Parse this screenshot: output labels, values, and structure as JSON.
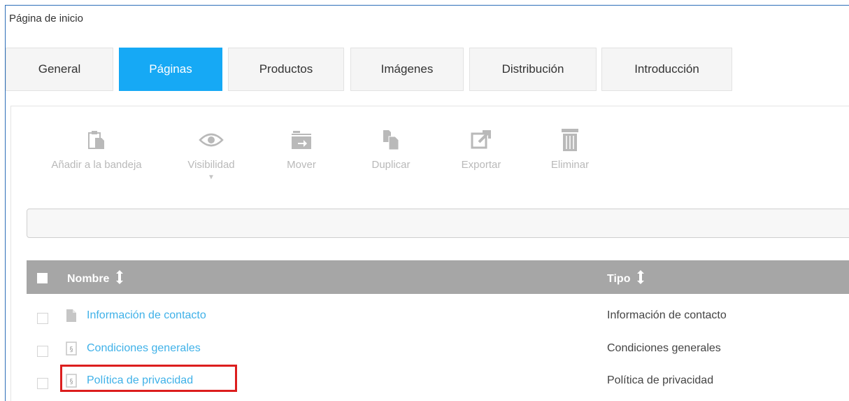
{
  "page": {
    "title": "Página de inicio"
  },
  "tabs": [
    {
      "label": "General",
      "active": false
    },
    {
      "label": "Páginas",
      "active": true
    },
    {
      "label": "Productos",
      "active": false
    },
    {
      "label": "Imágenes",
      "active": false
    },
    {
      "label": "Distribución",
      "active": false
    },
    {
      "label": "Introducción",
      "active": false
    }
  ],
  "toolbar": [
    {
      "label": "Añadir a la bandeja",
      "icon": "clipboard-icon"
    },
    {
      "label": "Visibilidad",
      "icon": "eye-icon",
      "caret": "▼"
    },
    {
      "label": "Mover",
      "icon": "folder-move-icon"
    },
    {
      "label": "Duplicar",
      "icon": "duplicate-icon"
    },
    {
      "label": "Exportar",
      "icon": "export-icon"
    },
    {
      "label": "Eliminar",
      "icon": "trash-icon"
    }
  ],
  "table": {
    "headers": {
      "name": "Nombre",
      "type": "Tipo"
    },
    "rows": [
      {
        "name": "Información de contacto",
        "type": "Información de contacto",
        "icon": "document-icon"
      },
      {
        "name": "Condiciones generales",
        "type": "Condiciones generales",
        "icon": "section-document-icon"
      },
      {
        "name": "Política de privacidad",
        "type": "Política de privacidad",
        "icon": "section-document-icon",
        "highlighted": true
      }
    ]
  },
  "colors": {
    "accent": "#16a9f5",
    "link": "#3fb1e8",
    "header_bg": "#a6a6a6",
    "highlight": "#dc1e1e",
    "disabled": "#b9b9b9"
  }
}
